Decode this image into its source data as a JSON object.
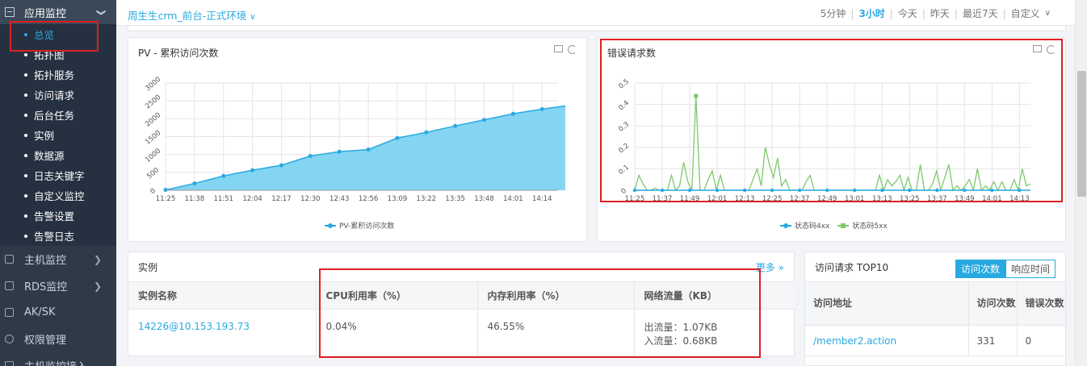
{
  "sidebar": {
    "section": "应用监控",
    "sub_items": [
      "总览",
      "拓扑图",
      "拓扑服务",
      "访问请求",
      "后台任务",
      "实例",
      "数据源",
      "日志关键字",
      "自定义监控",
      "告警设置",
      "告警日志"
    ],
    "active_item": "总览",
    "main_items": [
      "主机监控",
      "RDS监控",
      "AK/SK",
      "权限管理",
      "主机监控接入"
    ]
  },
  "header": {
    "environment": "周生生crm_前台-正式环境",
    "time_ranges": [
      "5分钟",
      "3小时",
      "今天",
      "昨天",
      "最近7天",
      "自定义"
    ],
    "selected_range": "3小时"
  },
  "pv_panel": {
    "title": "PV - 累积访问次数"
  },
  "error_panel": {
    "title": "错误请求数"
  },
  "chart_data": [
    {
      "type": "area",
      "title": "PV - 累积访问次数",
      "x_ticks": [
        "11:25",
        "11:38",
        "11:51",
        "12:04",
        "12:17",
        "12:30",
        "12:43",
        "12:56",
        "13:09",
        "13:22",
        "13:35",
        "13:48",
        "14:01",
        "14:14"
      ],
      "y_ticks": [
        "0",
        "500",
        "1000",
        "1500",
        "2000",
        "2500",
        "3000"
      ],
      "ylim": [
        0,
        3000
      ],
      "series": [
        {
          "name": "PV-累积访问次数",
          "color": "#27a9e1",
          "x": [
            0,
            1,
            2,
            3,
            4,
            5,
            6,
            7,
            8,
            9,
            10,
            11,
            12,
            13,
            13.8
          ],
          "values": [
            10,
            190,
            400,
            560,
            700,
            960,
            1080,
            1140,
            1460,
            1620,
            1800,
            1970,
            2140,
            2270,
            2360
          ]
        }
      ]
    },
    {
      "type": "line",
      "title": "错误请求数",
      "x_ticks": [
        "11:25",
        "11:37",
        "11:49",
        "12:01",
        "12:13",
        "12:25",
        "12:37",
        "12:49",
        "13:01",
        "13:13",
        "13:25",
        "13:37",
        "13:49",
        "14:01",
        "14:13"
      ],
      "y_ticks": [
        "0",
        "0.1",
        "0.2",
        "0.3",
        "0.4",
        "0.5"
      ],
      "ylim": [
        0,
        0.5
      ],
      "series": [
        {
          "name": "状态码4xx",
          "color": "#27a9e1",
          "values": [
            0,
            0,
            0,
            0,
            0,
            0,
            0,
            0,
            0,
            0,
            0,
            0,
            0,
            0,
            0,
            0,
            0,
            0,
            0,
            0,
            0,
            0,
            0,
            0,
            0,
            0,
            0,
            0,
            0,
            0,
            0,
            0,
            0,
            0,
            0,
            0,
            0,
            0,
            0,
            0,
            0,
            0,
            0,
            0,
            0,
            0,
            0,
            0,
            0,
            0,
            0,
            0,
            0,
            0,
            0,
            0,
            0,
            0,
            0,
            0,
            0,
            0,
            0,
            0,
            0,
            0,
            0,
            0,
            0,
            0,
            0,
            0,
            0,
            0,
            0,
            0,
            0,
            0,
            0,
            0,
            0,
            0,
            0,
            0,
            0,
            0,
            0,
            0,
            0,
            0
          ]
        },
        {
          "name": "状态码5xx",
          "color": "#7cc96a",
          "values": [
            0,
            0.07,
            0.03,
            0,
            0,
            0.01,
            0,
            0,
            0,
            0.07,
            0,
            0.02,
            0.13,
            0.04,
            0,
            0.44,
            0,
            0,
            0.05,
            0.09,
            0,
            0.07,
            0,
            0,
            0,
            0,
            0,
            0,
            0,
            0.05,
            0.1,
            0.02,
            0.2,
            0.12,
            0.06,
            0.15,
            0.02,
            0.05,
            0,
            0,
            0,
            0,
            0.04,
            0.07,
            0,
            0,
            0,
            0,
            0,
            0,
            0,
            0,
            0,
            0,
            0,
            0,
            0,
            0,
            0,
            0,
            0.07,
            0,
            0.05,
            0.02,
            0.04,
            0.07,
            0,
            0.06,
            0,
            0,
            0.12,
            0,
            0,
            0.03,
            0.09,
            0,
            0.06,
            0.12,
            0,
            0.02,
            0,
            0.02,
            0.05,
            0,
            0.1,
            0,
            0.02,
            0,
            0.04,
            0,
            0.04,
            0,
            0,
            0.05,
            0,
            0.1,
            0.02,
            0.03
          ]
        }
      ]
    }
  ],
  "instances": {
    "title": "实例",
    "more_label": "更多 »",
    "headers": [
      "实例名称",
      "CPU利用率（%）",
      "内存利用率（%）",
      "网络流量（KB）"
    ],
    "rows": [
      {
        "name": "14226@10.153.193.73",
        "cpu": "0.04%",
        "mem": "46.55%",
        "net_out": "出流量：1.07KB",
        "net_in": "入流量：0.68KB"
      }
    ]
  },
  "top10": {
    "title": "访问请求 TOP10",
    "tabs": [
      "访问次数",
      "响应时间"
    ],
    "active_tab": "访问次数",
    "headers": [
      "访问地址",
      "访问次数",
      "错误次数"
    ],
    "rows": [
      {
        "url": "/member2.action",
        "count": "331",
        "errors": "0"
      }
    ]
  }
}
